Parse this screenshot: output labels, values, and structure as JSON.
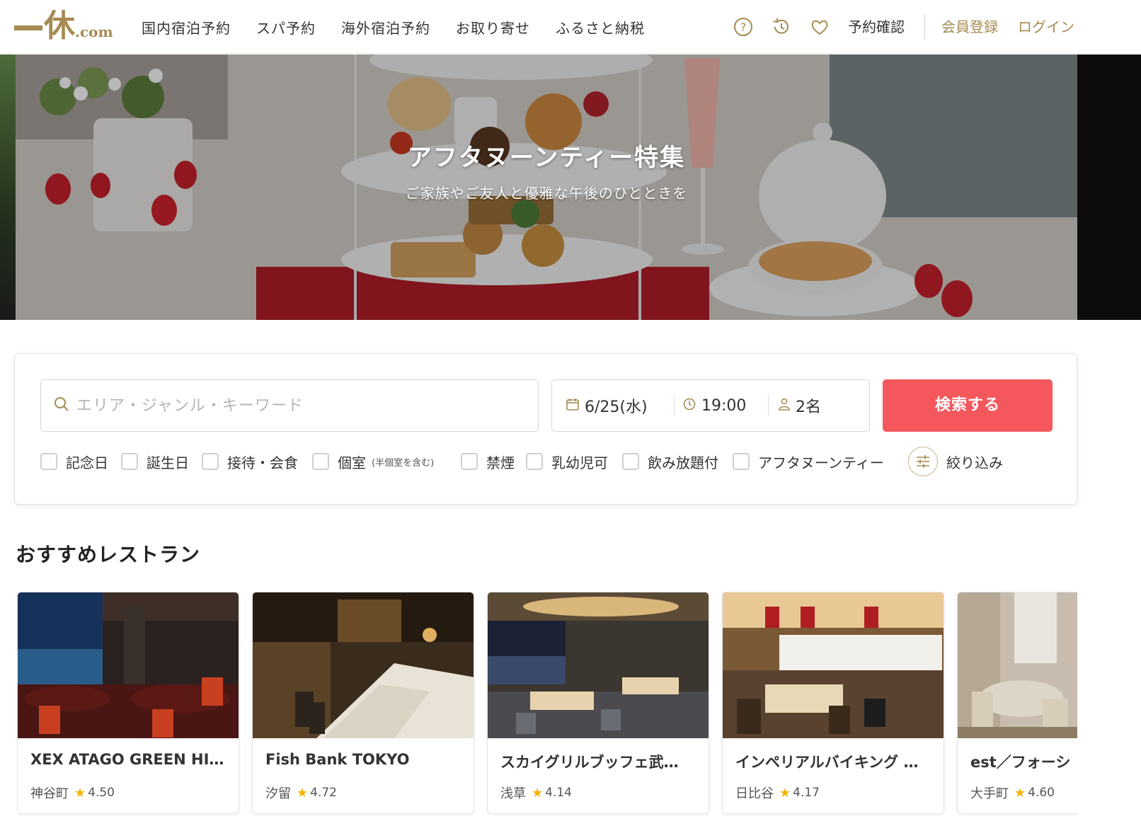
{
  "header": {
    "logo_kanji": "休",
    "logo_com": ".com",
    "nav": [
      "国内宿泊予約",
      "スパ予約",
      "海外宿泊予約",
      "お取り寄せ",
      "ふるさと納税"
    ],
    "reservation_check": "予約確認",
    "register": "会員登録",
    "login": "ログイン"
  },
  "hero": {
    "title": "アフタヌーンティー特集",
    "subtitle": "ご家族やご友人と優雅な午後のひとときを"
  },
  "search": {
    "placeholder": "エリア・ジャンル・キーワード",
    "date": "6/25(水)",
    "time": "19:00",
    "people": "2名",
    "button": "検索する",
    "filters": [
      {
        "label": "記念日"
      },
      {
        "label": "誕生日"
      },
      {
        "label": "接待・会食"
      },
      {
        "label": "個室",
        "note": "(半個室を含む)"
      },
      {
        "label": "禁煙"
      },
      {
        "label": "乳幼児可"
      },
      {
        "label": "飲み放題付"
      },
      {
        "label": "アフタヌーンティー"
      }
    ],
    "narrow": "絞り込み"
  },
  "recommend": {
    "title": "おすすめレストラン",
    "cards": [
      {
        "name": "XEX ATAGO GREEN HILLS",
        "area": "神谷町",
        "rating": "4.50"
      },
      {
        "name": "Fish Bank TOKYO",
        "area": "汐留",
        "rating": "4.72"
      },
      {
        "name": "スカイグリルブッフェ武…",
        "area": "浅草",
        "rating": "4.14"
      },
      {
        "name": "インペリアルバイキング …",
        "area": "日比谷",
        "rating": "4.17"
      },
      {
        "name": "est／フォーシ",
        "area": "大手町",
        "rating": "4.60"
      }
    ]
  },
  "colors": {
    "brand_gold": "#a58a51",
    "search_button": "#f4585d",
    "star": "#f5b400"
  },
  "icons": [
    "help-icon",
    "history-icon",
    "heart-icon",
    "search-icon",
    "calendar-icon",
    "clock-icon",
    "person-icon",
    "filter-sliders-icon",
    "star-icon"
  ]
}
